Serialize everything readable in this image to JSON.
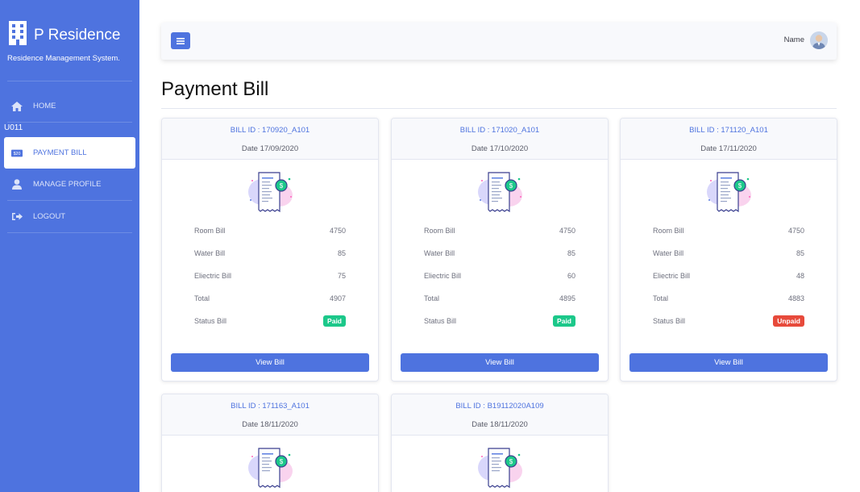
{
  "sidebar": {
    "brand_name": "P Residence",
    "brand_sub": "Residence Management System.",
    "user_code": "U011",
    "items": [
      {
        "label": "HOME",
        "icon": "home-icon"
      },
      {
        "label": "PAYMENT BILL",
        "icon": "bill-icon"
      },
      {
        "label": "MANAGE PROFILE",
        "icon": "user-icon"
      },
      {
        "label": "LOGOUT",
        "icon": "logout-icon"
      }
    ]
  },
  "topbar": {
    "user_name": "Name"
  },
  "page": {
    "title": "Payment Bill"
  },
  "labels": {
    "room": "Room Bill",
    "water": "Water Bill",
    "electric": "Eliectric Bill",
    "total": "Total",
    "status": "Status Bill",
    "view": "View Bill"
  },
  "bills": [
    {
      "id": "BILL ID : 170920_A101",
      "date": "Date 17/09/2020",
      "room": "4750",
      "water": "85",
      "electric": "75",
      "total": "4907",
      "status": "Paid"
    },
    {
      "id": "BILL ID : 171020_A101",
      "date": "Date 17/10/2020",
      "room": "4750",
      "water": "85",
      "electric": "60",
      "total": "4895",
      "status": "Paid"
    },
    {
      "id": "BILL ID : 171120_A101",
      "date": "Date 17/11/2020",
      "room": "4750",
      "water": "85",
      "electric": "48",
      "total": "4883",
      "status": "Unpaid"
    },
    {
      "id": "BILL ID : 171163_A101",
      "date": "Date 18/11/2020"
    },
    {
      "id": "BILL ID : B19112020A109",
      "date": "Date 18/11/2020"
    }
  ],
  "colors": {
    "primary": "#4e73df",
    "paid": "#1cc88a",
    "unpaid": "#e74a3b"
  }
}
